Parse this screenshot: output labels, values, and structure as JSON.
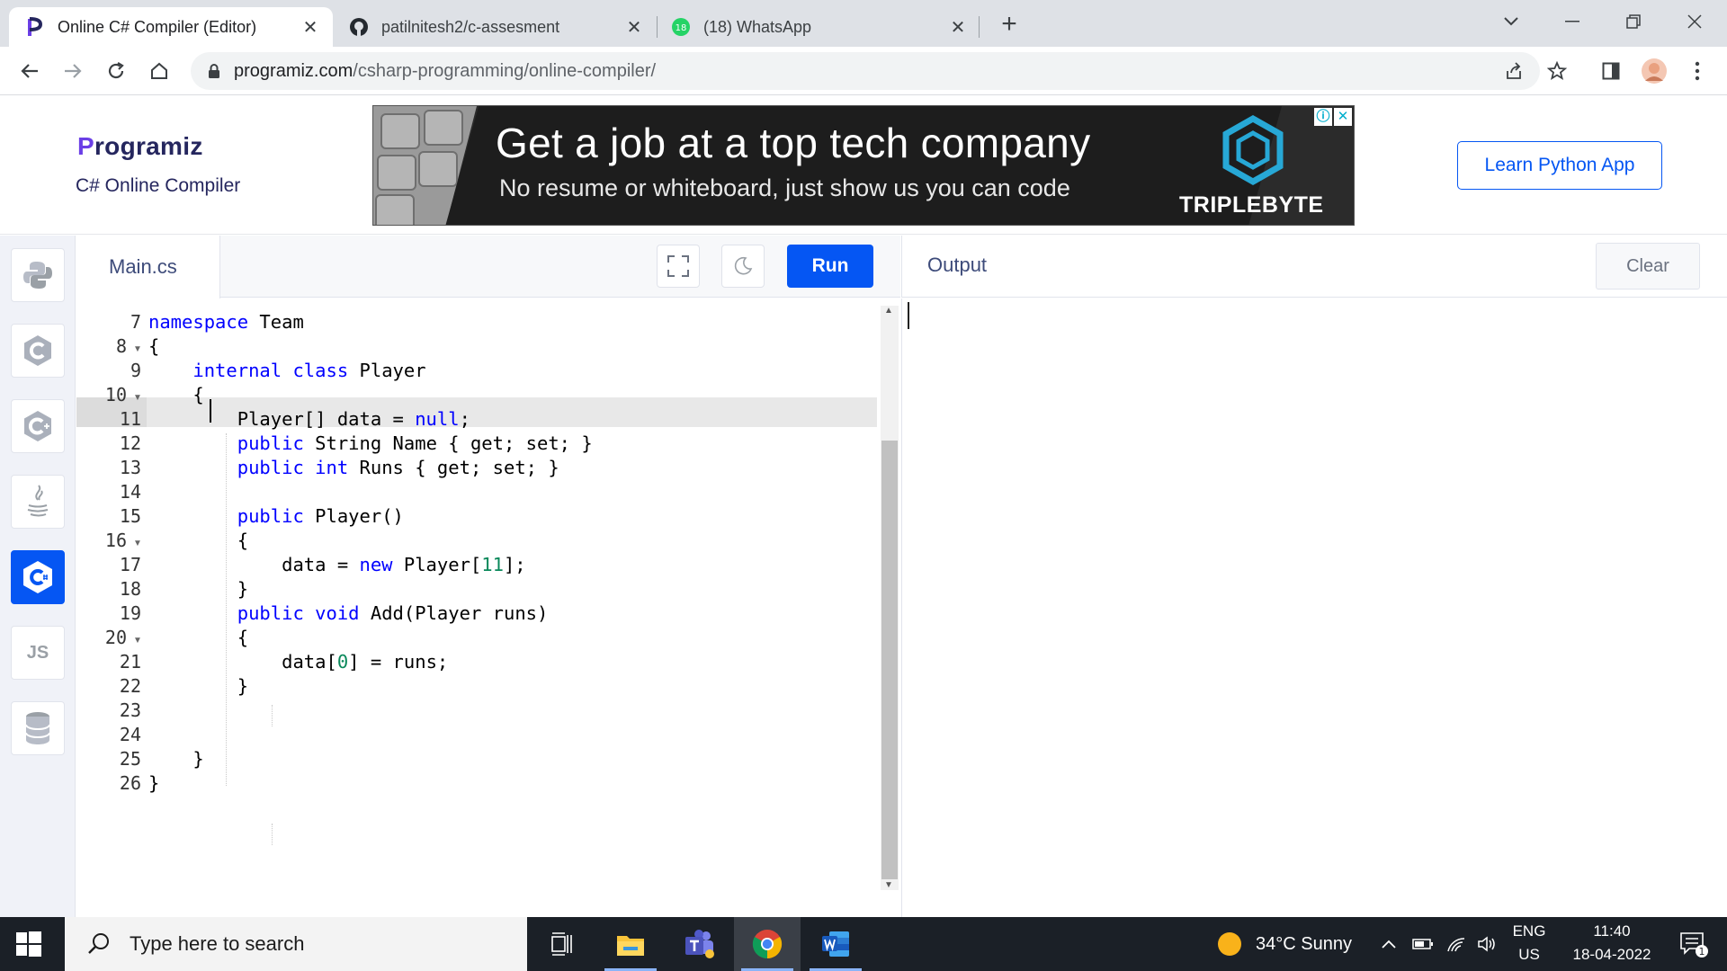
{
  "browser": {
    "tabs": [
      {
        "title": "Online C# Compiler (Editor)",
        "favicon": "programiz-icon",
        "active": true
      },
      {
        "title": "patilnitesh2/c-assesment",
        "favicon": "github-icon",
        "active": false
      },
      {
        "title": "(18) WhatsApp",
        "favicon": "whatsapp-icon",
        "badge": "18",
        "active": false
      }
    ],
    "url_host": "programiz.com",
    "url_path": "/csharp-programming/online-compiler/"
  },
  "header": {
    "logo_initial": "P",
    "logo_rest": "rogramiz",
    "subtitle": "C# Online Compiler",
    "learn_button": "Learn Python App"
  },
  "ad": {
    "headline": "Get a job at a top tech company",
    "tagline": "No resume or whiteboard, just show us you can code",
    "brand": "TRIPLEBYTE",
    "info_glyph": "ⓘ",
    "close_glyph": "✕"
  },
  "rail": {
    "items": [
      {
        "name": "python",
        "icon": "python-icon",
        "label": ""
      },
      {
        "name": "c",
        "icon": "c-icon",
        "label": ""
      },
      {
        "name": "cpp",
        "icon": "cpp-icon",
        "label": ""
      },
      {
        "name": "java",
        "icon": "java-icon",
        "label": ""
      },
      {
        "name": "csharp",
        "icon": "csharp-icon",
        "label": "",
        "active": true
      },
      {
        "name": "js",
        "icon": "js-icon",
        "label": "JS"
      },
      {
        "name": "sql",
        "icon": "database-icon",
        "label": ""
      }
    ]
  },
  "editor": {
    "file_name": "Main.cs",
    "run_label": "Run",
    "top_partial_line": "-",
    "line_numbers": [
      "7",
      "8",
      "9",
      "10",
      "11",
      "12",
      "13",
      "14",
      "15",
      "16",
      "17",
      "18",
      "19",
      "20",
      "21",
      "22",
      "23",
      "24",
      "25",
      "26"
    ],
    "fold_lines": [
      "8",
      "10",
      "16",
      "20"
    ],
    "active_line": "10"
  },
  "output": {
    "title": "Output",
    "clear_label": "Clear"
  },
  "taskbar": {
    "search_placeholder": "Type here to search",
    "weather": "34°C  Sunny",
    "lang_top": "ENG",
    "lang_bottom": "US",
    "time": "11:40",
    "date": "18-04-2022",
    "notification_count": "1"
  },
  "colors": {
    "accent": "#0556f3",
    "keyword": "#0000ff",
    "number": "#09885a",
    "taskbar": "#1b2027"
  }
}
